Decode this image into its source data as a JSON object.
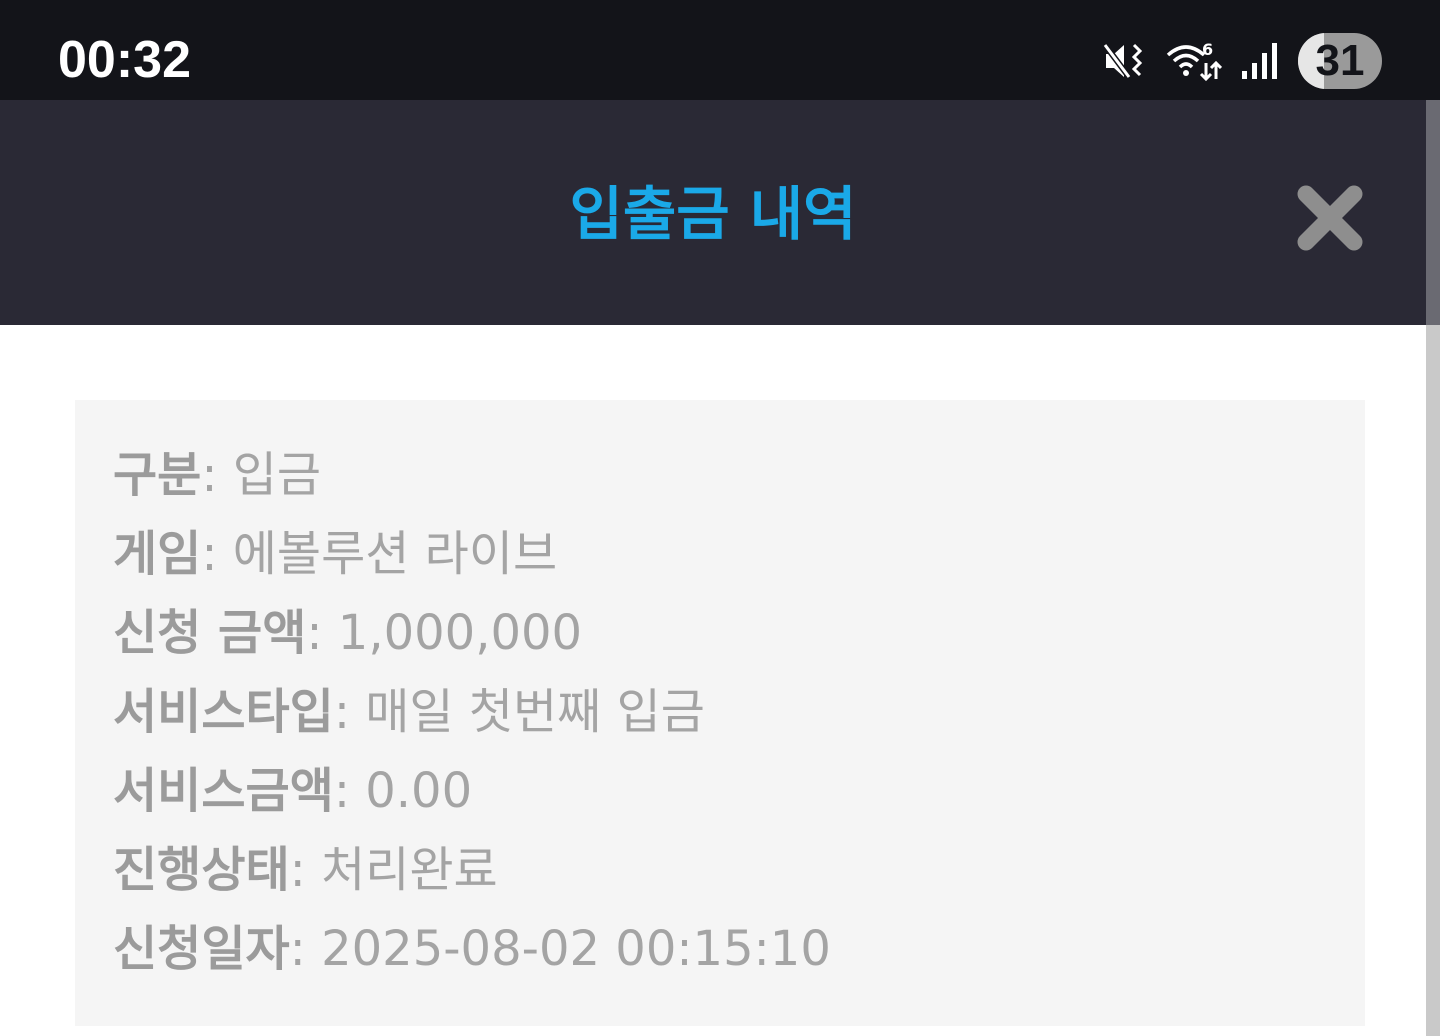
{
  "status_bar": {
    "time": "00:32",
    "icons": [
      "mute-vibrate-icon",
      "wifi-6-icon",
      "cell-signal-icon"
    ],
    "battery": "31",
    "battery_level_percent": 31
  },
  "header": {
    "title": "입출금 내역",
    "title_color": "#1aa9e8",
    "close_icon": "close-icon"
  },
  "details": {
    "category": {
      "label": "구분",
      "value": "입금"
    },
    "game": {
      "label": "게임",
      "value": "에볼루션 라이브"
    },
    "request_amount": {
      "label": "신청 금액",
      "value": "1,000,000"
    },
    "service_type": {
      "label": "서비스타입",
      "value": "매일 첫번째 입금"
    },
    "service_amount": {
      "label": "서비스금액",
      "value": "0.00"
    },
    "status": {
      "label": "진행상태",
      "value": "처리완료"
    },
    "request_date": {
      "label": "신청일자",
      "value": "2025-08-02 00:15:10"
    }
  }
}
